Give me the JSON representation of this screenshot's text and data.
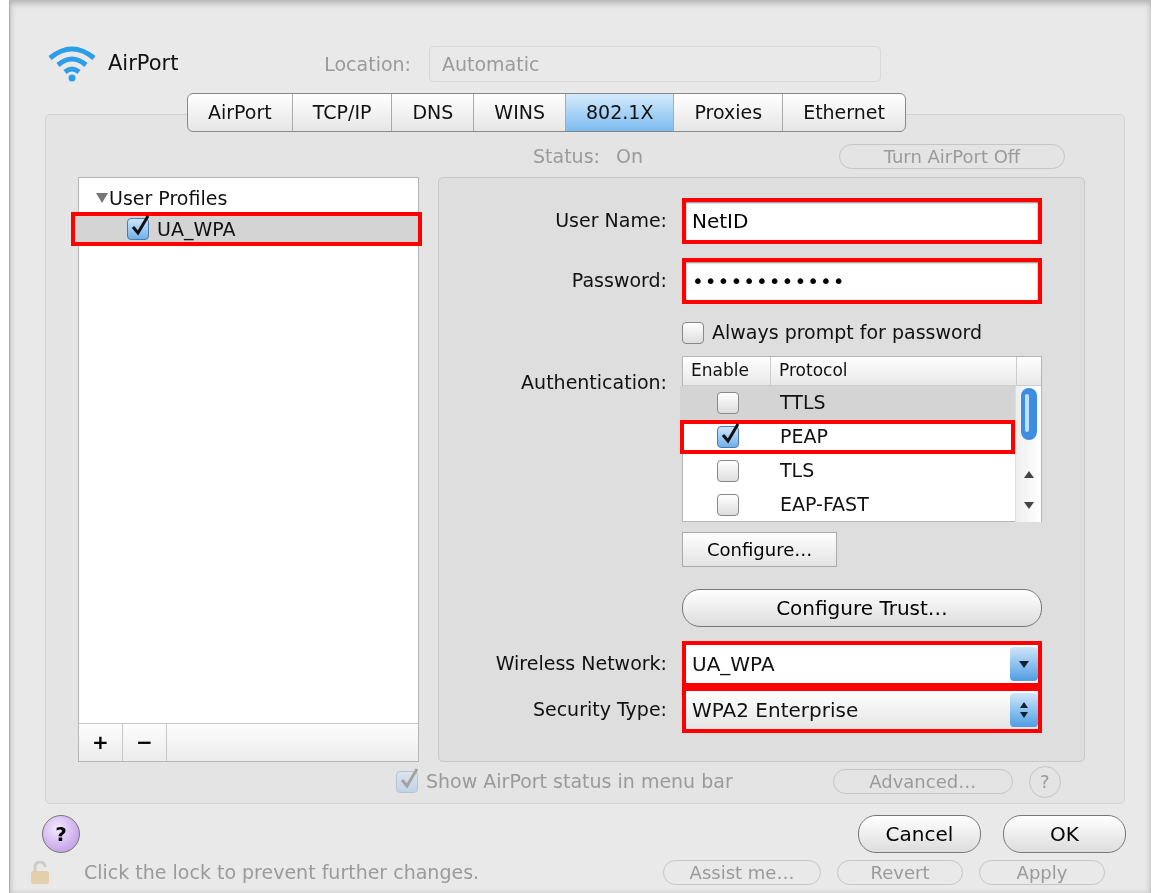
{
  "window": {
    "title": "AirPort"
  },
  "location": {
    "label": "Location:",
    "value": "Automatic"
  },
  "tabs": [
    {
      "label": "AirPort",
      "selected": false
    },
    {
      "label": "TCP/IP",
      "selected": false
    },
    {
      "label": "DNS",
      "selected": false
    },
    {
      "label": "WINS",
      "selected": false
    },
    {
      "label": "802.1X",
      "selected": true
    },
    {
      "label": "Proxies",
      "selected": false
    },
    {
      "label": "Ethernet",
      "selected": false
    }
  ],
  "background_status": {
    "label": "Status:",
    "value": "On",
    "button": "Turn AirPort Off"
  },
  "profiles": {
    "header": "User Profiles",
    "expanded": true,
    "items": [
      {
        "name": "UA_WPA",
        "checked": true,
        "selected": true,
        "highlighted": true
      }
    ],
    "buttons": [
      "+",
      "−"
    ]
  },
  "form": {
    "user_name": {
      "label": "User Name:",
      "value": "NetID",
      "highlighted": true
    },
    "password": {
      "label": "Password:",
      "value": "••••••••••••",
      "highlighted": true
    },
    "always_prompt": {
      "label": "Always prompt for password",
      "checked": false
    },
    "authentication": {
      "label": "Authentication:",
      "columns": [
        "Enable",
        "Protocol"
      ],
      "rows": [
        {
          "protocol": "TTLS",
          "enabled": false,
          "selected": true,
          "highlighted": false
        },
        {
          "protocol": "PEAP",
          "enabled": true,
          "selected": false,
          "highlighted": true
        },
        {
          "protocol": "TLS",
          "enabled": false,
          "selected": false,
          "highlighted": false
        },
        {
          "protocol": "EAP-FAST",
          "enabled": false,
          "selected": false,
          "highlighted": false
        }
      ]
    },
    "configure_button": "Configure…",
    "trust_button": "Configure Trust…",
    "wireless_network": {
      "label": "Wireless Network:",
      "value": "UA_WPA",
      "highlighted": true
    },
    "security_type": {
      "label": "Security Type:",
      "value": "WPA2 Enterprise",
      "highlighted": true
    }
  },
  "background_options": {
    "show_status": {
      "label": "Show AirPort status in menu bar",
      "checked": true
    },
    "advanced_button": "Advanced…",
    "help": "?"
  },
  "buttons": {
    "help": "?",
    "cancel": "Cancel",
    "ok": "OK"
  },
  "footer": {
    "lock_text": "Click the lock to prevent further changes.",
    "buttons": [
      "Assist me…",
      "Revert",
      "Apply"
    ]
  }
}
